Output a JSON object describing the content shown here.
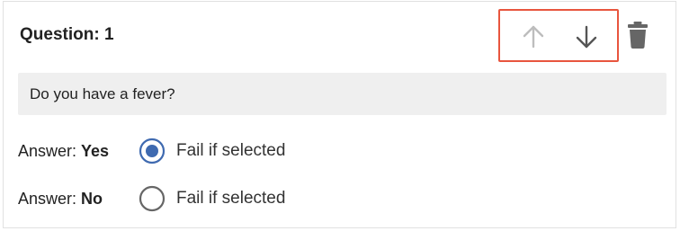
{
  "question": {
    "title": "Question: 1",
    "text": "Do you have a fever?"
  },
  "controls": {
    "up_icon": "arrow-up-icon",
    "down_icon": "arrow-down-icon",
    "delete_icon": "trash-icon",
    "highlight_color": "#e8553e"
  },
  "answers": [
    {
      "prefix": "Answer: ",
      "value": "Yes",
      "option_label": "Fail if selected",
      "selected": true
    },
    {
      "prefix": "Answer: ",
      "value": "No",
      "option_label": "Fail if selected",
      "selected": false
    }
  ],
  "colors": {
    "radio_selected": "#3f6ab0",
    "radio_unselected": "#666666",
    "disabled_arrow": "#bdbdbd",
    "enabled_arrow": "#555555"
  }
}
